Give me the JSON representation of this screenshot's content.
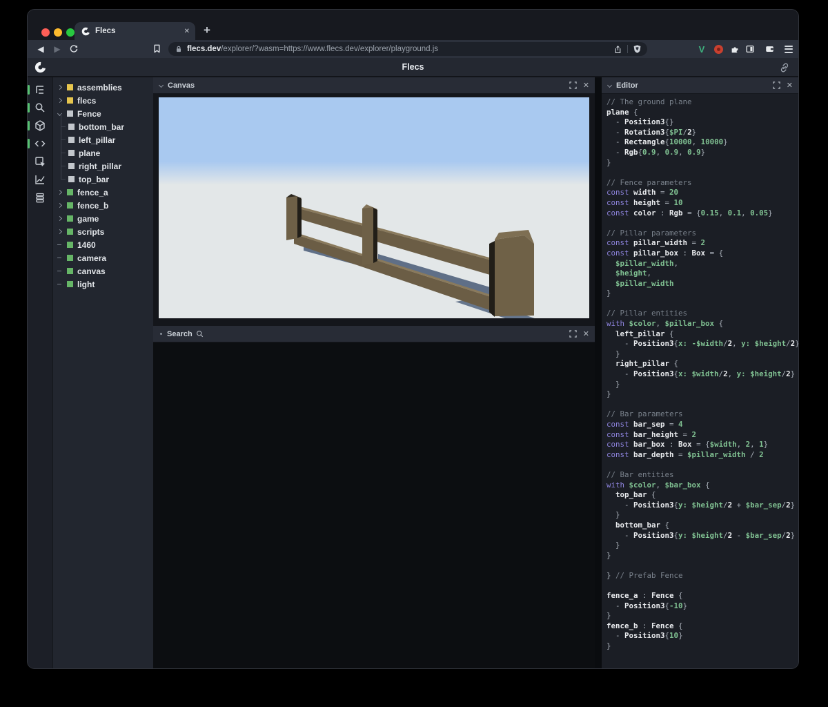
{
  "browser": {
    "tab_title": "Flecs",
    "tab_close": "✕",
    "new_tab": "+",
    "back_glyph": "◀",
    "forward_glyph": "▶",
    "url": {
      "domain": "flecs.dev",
      "path": "/explorer/?wasm=https://www.flecs.dev/explorer/playground.js"
    },
    "extension_icons": [
      "vue-extension-icon",
      "adblock-extension-icon",
      "extensions-puzzle-icon",
      "sidebar-toggle-icon",
      "wallet-icon",
      "menu-icon"
    ]
  },
  "header": {
    "title": "Flecs",
    "logo": "flecs-logo",
    "link_icon": "share-link-icon"
  },
  "activity_bar": {
    "items": [
      {
        "icon": "entity-tree-icon",
        "active": true
      },
      {
        "icon": "search-icon",
        "active": true
      },
      {
        "icon": "scene-cube-icon",
        "active": true
      },
      {
        "icon": "code-editor-icon",
        "active": true
      },
      {
        "icon": "inspector-icon",
        "active": false
      },
      {
        "icon": "stats-chart-icon",
        "active": false
      },
      {
        "icon": "commands-stack-icon",
        "active": false
      }
    ]
  },
  "tree": {
    "items": [
      {
        "label": "assemblies",
        "depth": 0,
        "toggle": "collapsed",
        "color": "yellow"
      },
      {
        "label": "flecs",
        "depth": 0,
        "toggle": "collapsed",
        "color": "yellow"
      },
      {
        "label": "Fence",
        "depth": 0,
        "toggle": "expanded",
        "color": "gray"
      },
      {
        "label": "bottom_bar",
        "depth": 1,
        "toggle": "none",
        "color": "gray"
      },
      {
        "label": "left_pillar",
        "depth": 1,
        "toggle": "none",
        "color": "gray"
      },
      {
        "label": "plane",
        "depth": 1,
        "toggle": "none",
        "color": "gray"
      },
      {
        "label": "right_pillar",
        "depth": 1,
        "toggle": "none",
        "color": "gray"
      },
      {
        "label": "top_bar",
        "depth": 1,
        "toggle": "none",
        "color": "gray"
      },
      {
        "label": "fence_a",
        "depth": 0,
        "toggle": "collapsed",
        "color": "green"
      },
      {
        "label": "fence_b",
        "depth": 0,
        "toggle": "collapsed",
        "color": "green"
      },
      {
        "label": "game",
        "depth": 0,
        "toggle": "collapsed",
        "color": "green"
      },
      {
        "label": "scripts",
        "depth": 0,
        "toggle": "collapsed",
        "color": "green"
      },
      {
        "label": "1460",
        "depth": 0,
        "toggle": "leaf",
        "color": "green"
      },
      {
        "label": "camera",
        "depth": 0,
        "toggle": "leaf",
        "color": "green"
      },
      {
        "label": "canvas",
        "depth": 0,
        "toggle": "leaf",
        "color": "green"
      },
      {
        "label": "light",
        "depth": 0,
        "toggle": "leaf",
        "color": "green"
      }
    ]
  },
  "panels": {
    "canvas": {
      "title": "Canvas",
      "close": "✕"
    },
    "search": {
      "title": "Search",
      "close": "✕"
    },
    "editor": {
      "title": "Editor",
      "close": "✕"
    }
  },
  "colors": {
    "accent_green": "#56c271",
    "square_yellow": "#e7c64e",
    "square_green": "#66b567",
    "code_keyword": "#8f85e0",
    "code_value": "#80c192",
    "sky": "#a9c9f0",
    "ground": "#e3e7e8",
    "fence_wood": "#6b5d45",
    "fence_dark": "#211e18",
    "fence_shadow": "#50627c"
  },
  "scene": {
    "description": "3D fence: left, middle and right pillars with two horizontal bars on a light ground under a blue sky"
  },
  "editor": {
    "lines": [
      [
        [
          "c",
          "// The ground plane"
        ]
      ],
      [
        [
          "i",
          "plane"
        ],
        [
          "p",
          " {"
        ]
      ],
      [
        [
          "p",
          "  - "
        ],
        [
          "i",
          "Position3"
        ],
        [
          "p",
          "{}"
        ]
      ],
      [
        [
          "p",
          "  - "
        ],
        [
          "i",
          "Rotation3"
        ],
        [
          "p",
          "{"
        ],
        [
          "v",
          "$PI"
        ],
        [
          "p",
          "/"
        ],
        [
          "i",
          "2"
        ],
        [
          "p",
          "}"
        ]
      ],
      [
        [
          "p",
          "  - "
        ],
        [
          "i",
          "Rectangle"
        ],
        [
          "p",
          "{"
        ],
        [
          "n",
          "10000"
        ],
        [
          "p",
          ", "
        ],
        [
          "n",
          "10000"
        ],
        [
          "p",
          "}"
        ]
      ],
      [
        [
          "p",
          "  - "
        ],
        [
          "i",
          "Rgb"
        ],
        [
          "p",
          "{"
        ],
        [
          "n",
          "0.9"
        ],
        [
          "p",
          ", "
        ],
        [
          "n",
          "0.9"
        ],
        [
          "p",
          ", "
        ],
        [
          "n",
          "0.9"
        ],
        [
          "p",
          "}"
        ]
      ],
      [
        [
          "p",
          "}"
        ]
      ],
      [],
      [
        [
          "c",
          "// Fence parameters"
        ]
      ],
      [
        [
          "k",
          "const "
        ],
        [
          "i",
          "width"
        ],
        [
          "p",
          " = "
        ],
        [
          "n",
          "20"
        ]
      ],
      [
        [
          "k",
          "const "
        ],
        [
          "i",
          "height"
        ],
        [
          "p",
          " = "
        ],
        [
          "n",
          "10"
        ]
      ],
      [
        [
          "k",
          "const "
        ],
        [
          "i",
          "color"
        ],
        [
          "p",
          " : "
        ],
        [
          "i",
          "Rgb"
        ],
        [
          "p",
          " = {"
        ],
        [
          "n",
          "0.15"
        ],
        [
          "p",
          ", "
        ],
        [
          "n",
          "0.1"
        ],
        [
          "p",
          ", "
        ],
        [
          "n",
          "0.05"
        ],
        [
          "p",
          "}"
        ]
      ],
      [],
      [
        [
          "c",
          "// Pillar parameters"
        ]
      ],
      [
        [
          "k",
          "const "
        ],
        [
          "i",
          "pillar_width"
        ],
        [
          "p",
          " = "
        ],
        [
          "n",
          "2"
        ]
      ],
      [
        [
          "k",
          "const "
        ],
        [
          "i",
          "pillar_box"
        ],
        [
          "p",
          " : "
        ],
        [
          "i",
          "Box"
        ],
        [
          "p",
          " = {"
        ]
      ],
      [
        [
          "v",
          "  $pillar_width"
        ],
        [
          "p",
          ","
        ]
      ],
      [
        [
          "v",
          "  $height"
        ],
        [
          "p",
          ","
        ]
      ],
      [
        [
          "v",
          "  $pillar_width"
        ]
      ],
      [
        [
          "p",
          "}"
        ]
      ],
      [],
      [
        [
          "c",
          "// Pillar entities"
        ]
      ],
      [
        [
          "k",
          "with "
        ],
        [
          "v",
          "$color"
        ],
        [
          "p",
          ", "
        ],
        [
          "v",
          "$pillar_box"
        ],
        [
          "p",
          " {"
        ]
      ],
      [
        [
          "i",
          "  left_pillar"
        ],
        [
          "p",
          " {"
        ]
      ],
      [
        [
          "p",
          "    - "
        ],
        [
          "i",
          "Position3"
        ],
        [
          "p",
          "{"
        ],
        [
          "v",
          "x: -$width"
        ],
        [
          "p",
          "/"
        ],
        [
          "i",
          "2"
        ],
        [
          "p",
          ", "
        ],
        [
          "v",
          "y: $height"
        ],
        [
          "p",
          "/"
        ],
        [
          "i",
          "2"
        ],
        [
          "p",
          "}"
        ]
      ],
      [
        [
          "p",
          "  }"
        ]
      ],
      [
        [
          "i",
          "  right_pillar"
        ],
        [
          "p",
          " {"
        ]
      ],
      [
        [
          "p",
          "    - "
        ],
        [
          "i",
          "Position3"
        ],
        [
          "p",
          "{"
        ],
        [
          "v",
          "x: $width"
        ],
        [
          "p",
          "/"
        ],
        [
          "i",
          "2"
        ],
        [
          "p",
          ", "
        ],
        [
          "v",
          "y: $height"
        ],
        [
          "p",
          "/"
        ],
        [
          "i",
          "2"
        ],
        [
          "p",
          "}"
        ]
      ],
      [
        [
          "p",
          "  }"
        ]
      ],
      [
        [
          "p",
          "}"
        ]
      ],
      [],
      [
        [
          "c",
          "// Bar parameters"
        ]
      ],
      [
        [
          "k",
          "const "
        ],
        [
          "i",
          "bar_sep"
        ],
        [
          "p",
          " = "
        ],
        [
          "n",
          "4"
        ]
      ],
      [
        [
          "k",
          "const "
        ],
        [
          "i",
          "bar_height"
        ],
        [
          "p",
          " = "
        ],
        [
          "n",
          "2"
        ]
      ],
      [
        [
          "k",
          "const "
        ],
        [
          "i",
          "bar_box"
        ],
        [
          "p",
          " : "
        ],
        [
          "i",
          "Box"
        ],
        [
          "p",
          " = {"
        ],
        [
          "v",
          "$width"
        ],
        [
          "p",
          ", "
        ],
        [
          "n",
          "2"
        ],
        [
          "p",
          ", "
        ],
        [
          "n",
          "1"
        ],
        [
          "p",
          "}"
        ]
      ],
      [
        [
          "k",
          "const "
        ],
        [
          "i",
          "bar_depth"
        ],
        [
          "p",
          " = "
        ],
        [
          "v",
          "$pillar_width"
        ],
        [
          "p",
          " / "
        ],
        [
          "n",
          "2"
        ]
      ],
      [],
      [
        [
          "c",
          "// Bar entities"
        ]
      ],
      [
        [
          "k",
          "with "
        ],
        [
          "v",
          "$color"
        ],
        [
          "p",
          ", "
        ],
        [
          "v",
          "$bar_box"
        ],
        [
          "p",
          " {"
        ]
      ],
      [
        [
          "i",
          "  top_bar"
        ],
        [
          "p",
          " {"
        ]
      ],
      [
        [
          "p",
          "    - "
        ],
        [
          "i",
          "Position3"
        ],
        [
          "p",
          "{"
        ],
        [
          "v",
          "y: $height"
        ],
        [
          "p",
          "/"
        ],
        [
          "i",
          "2"
        ],
        [
          "p",
          " + "
        ],
        [
          "v",
          "$bar_sep"
        ],
        [
          "p",
          "/"
        ],
        [
          "i",
          "2"
        ],
        [
          "p",
          "}"
        ]
      ],
      [
        [
          "p",
          "  }"
        ]
      ],
      [
        [
          "i",
          "  bottom_bar"
        ],
        [
          "p",
          " {"
        ]
      ],
      [
        [
          "p",
          "    - "
        ],
        [
          "i",
          "Position3"
        ],
        [
          "p",
          "{"
        ],
        [
          "v",
          "y: $height"
        ],
        [
          "p",
          "/"
        ],
        [
          "i",
          "2"
        ],
        [
          "p",
          " - "
        ],
        [
          "v",
          "$bar_sep"
        ],
        [
          "p",
          "/"
        ],
        [
          "i",
          "2"
        ],
        [
          "p",
          "}"
        ]
      ],
      [
        [
          "p",
          "  }"
        ]
      ],
      [
        [
          "p",
          "}"
        ]
      ],
      [],
      [
        [
          "p",
          "} "
        ],
        [
          "c",
          "// Prefab Fence"
        ]
      ],
      [],
      [
        [
          "i",
          "fence_a"
        ],
        [
          "p",
          " : "
        ],
        [
          "i",
          "Fence"
        ],
        [
          "p",
          " {"
        ]
      ],
      [
        [
          "p",
          "  - "
        ],
        [
          "i",
          "Position3"
        ],
        [
          "p",
          "{"
        ],
        [
          "n",
          "-10"
        ],
        [
          "p",
          "}"
        ]
      ],
      [
        [
          "p",
          "}"
        ]
      ],
      [
        [
          "i",
          "fence_b"
        ],
        [
          "p",
          " : "
        ],
        [
          "i",
          "Fence"
        ],
        [
          "p",
          " {"
        ]
      ],
      [
        [
          "p",
          "  - "
        ],
        [
          "i",
          "Position3"
        ],
        [
          "p",
          "{"
        ],
        [
          "n",
          "10"
        ],
        [
          "p",
          "}"
        ]
      ],
      [
        [
          "p",
          "}"
        ]
      ]
    ]
  }
}
